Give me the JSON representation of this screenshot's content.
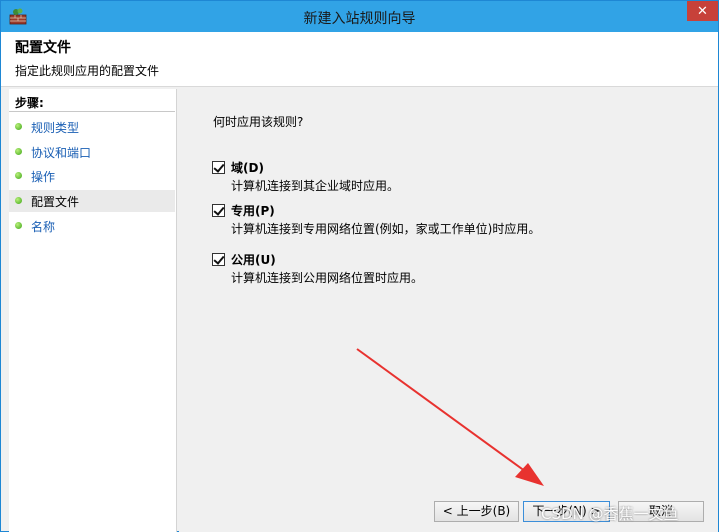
{
  "window": {
    "title": "新建入站规则向导",
    "close_symbol": "✕"
  },
  "header": {
    "title": "配置文件",
    "subtitle": "指定此规则应用的配置文件"
  },
  "sidebar": {
    "title": "步骤:",
    "items": [
      {
        "label": "规则类型",
        "active": false
      },
      {
        "label": "协议和端口",
        "active": false
      },
      {
        "label": "操作",
        "active": false
      },
      {
        "label": "配置文件",
        "active": true
      },
      {
        "label": "名称",
        "active": false
      }
    ]
  },
  "main": {
    "question": "何时应用该规则?",
    "options": [
      {
        "label": "域(D)",
        "description": "计算机连接到其企业域时应用。",
        "checked": true
      },
      {
        "label": "专用(P)",
        "description": "计算机连接到专用网络位置(例如，家或工作单位)时应用。",
        "checked": true
      },
      {
        "label": "公用(U)",
        "description": "计算机连接到公用网络位置时应用。",
        "checked": true
      }
    ]
  },
  "buttons": {
    "back": "< 上一步(B)",
    "next": "下一步(N) >",
    "cancel": "取消"
  },
  "watermark": "CSDN @香蕉一文鱼",
  "colors": {
    "titlebar": "#31a3e6",
    "close": "#c7413a",
    "arrow": "#e8322f",
    "link": "#1a5fb4"
  }
}
